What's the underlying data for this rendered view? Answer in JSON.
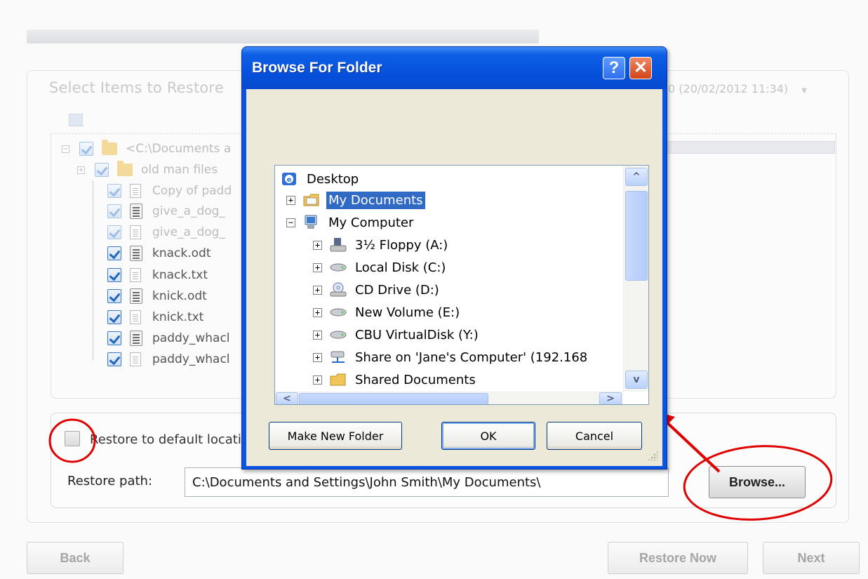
{
  "wizard": {
    "section_title": "Select Items to Restore",
    "backup_select": "0 (20/02/2012 11:34)",
    "tree_items": [
      {
        "label": "<C:\\Documents a",
        "kind": "folder",
        "dim": true
      },
      {
        "label": "old man files",
        "kind": "folder",
        "dim": true
      },
      {
        "label": "Copy of padd",
        "kind": "doc",
        "dim": true
      },
      {
        "label": "give_a_dog_",
        "kind": "odt",
        "dim": false
      },
      {
        "label": "give_a_dog_",
        "kind": "doc",
        "dim": true
      },
      {
        "label": "knack.odt",
        "kind": "odt",
        "dim": false
      },
      {
        "label": "knack.txt",
        "kind": "doc",
        "dim": false
      },
      {
        "label": "knick.odt",
        "kind": "odt",
        "dim": false
      },
      {
        "label": "knick.txt",
        "kind": "doc",
        "dim": false
      },
      {
        "label": "paddy_whacl",
        "kind": "odt",
        "dim": false
      },
      {
        "label": "paddy_whacl",
        "kind": "doc",
        "dim": false
      }
    ],
    "restore_default_label": "Restore to default locatio",
    "restore_path_label": "Restore path:",
    "restore_path_value": "C:\\Documents and Settings\\John Smith\\My Documents\\",
    "browse_label": "Browse...",
    "back_label": "Back",
    "restore_now_label": "Restore Now",
    "next_label": "Next"
  },
  "dialog": {
    "title": "Browse For Folder",
    "help_glyph": "?",
    "close_glyph": "✕",
    "expand_glyph": "+",
    "collapse_glyph": "−",
    "scroll_up_glyph": "^",
    "scroll_down_glyph": "v",
    "scroll_left_glyph": "<",
    "scroll_right_glyph": ">",
    "folders": {
      "desktop": "Desktop",
      "my_documents": "My Documents",
      "my_computer": "My Computer",
      "floppy": "3½ Floppy (A:)",
      "local_disk": "Local Disk (C:)",
      "cd_drive": "CD Drive (D:)",
      "new_volume": "New Volume (E:)",
      "cbu_disk": "CBU VirtualDisk (Y:)",
      "share": "Share on 'Jane's Computer' (192.168",
      "shared_docs": "Shared Documents"
    },
    "make_new_folder_label": "Make New Folder",
    "ok_label": "OK",
    "cancel_label": "Cancel"
  },
  "colors": {
    "xp_title_blue": "#0a54e3",
    "selection_blue": "#316ac5",
    "annotation_red": "#e00000",
    "dialog_face": "#ece9d8"
  }
}
